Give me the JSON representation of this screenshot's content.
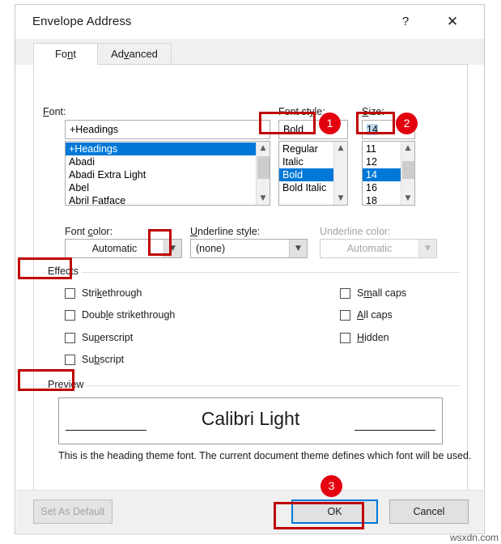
{
  "window": {
    "title": "Envelope Address",
    "help_icon": "question-mark-icon",
    "close_icon": "close-icon"
  },
  "tabs": [
    {
      "id": "font",
      "label_before": "Fo",
      "label_accel": "n",
      "label_after": "t",
      "active": true
    },
    {
      "id": "advanced",
      "label_before": "Ad",
      "label_accel": "v",
      "label_after": "anced",
      "active": false
    }
  ],
  "font_group": {
    "label_before": "",
    "label_accel": "F",
    "label_after": "ont:",
    "value": "+Headings",
    "items": [
      {
        "label": "+Headings",
        "selected": true
      },
      {
        "label": "Abadi",
        "selected": false
      },
      {
        "label": "Abadi Extra Light",
        "selected": false
      },
      {
        "label": "Abel",
        "selected": false
      },
      {
        "label": "Abril Fatface",
        "selected": false
      }
    ]
  },
  "style_group": {
    "label_before": "Font st",
    "label_accel": "y",
    "label_after": "le:",
    "value": "Bold",
    "items": [
      {
        "label": "Regular",
        "selected": false
      },
      {
        "label": "Italic",
        "selected": false
      },
      {
        "label": "Bold",
        "selected": true
      },
      {
        "label": "Bold Italic",
        "selected": false
      }
    ]
  },
  "size_group": {
    "label_before": "",
    "label_accel": "S",
    "label_after": "ize:",
    "value": "14",
    "items": [
      {
        "label": "11",
        "selected": false
      },
      {
        "label": "12",
        "selected": false
      },
      {
        "label": "14",
        "selected": true
      },
      {
        "label": "16",
        "selected": false
      },
      {
        "label": "18",
        "selected": false
      }
    ]
  },
  "font_color": {
    "label_before": "Font ",
    "label_accel": "c",
    "label_after": "olor:",
    "value": "Automatic",
    "dropdown_icon": "chevron-down-icon"
  },
  "underline_style": {
    "label_before": "",
    "label_accel": "U",
    "label_after": "nderline style:",
    "value": "(none)",
    "dropdown_icon": "chevron-down-icon"
  },
  "underline_color": {
    "label": "Underline color:",
    "value": "Automatic",
    "dropdown_icon": "chevron-down-icon",
    "disabled": true
  },
  "effects": {
    "group_label": "Effects",
    "left_column": [
      {
        "label_before": "Stri",
        "label_accel": "k",
        "label_after": "ethrough",
        "checked": false
      },
      {
        "label_before": "Doub",
        "label_accel": "l",
        "label_after": "e strikethrough",
        "checked": false
      },
      {
        "label_before": "Su",
        "label_accel": "p",
        "label_after": "erscript",
        "checked": false
      },
      {
        "label_before": "Su",
        "label_accel": "b",
        "label_after": "script",
        "checked": false
      }
    ],
    "right_column": [
      {
        "label_before": "S",
        "label_accel": "m",
        "label_after": "all caps",
        "checked": false
      },
      {
        "label_before": "",
        "label_accel": "A",
        "label_after": "ll caps",
        "checked": false
      },
      {
        "label_before": "",
        "label_accel": "H",
        "label_after": "idden",
        "checked": false
      }
    ]
  },
  "preview": {
    "group_label": "Preview",
    "sample_text": "Calibri Light",
    "note": "This is the heading theme font. The current document theme defines which font will be used."
  },
  "footer": {
    "set_as_default": "Set As Default",
    "ok": "OK",
    "cancel": "Cancel"
  },
  "annotations": {
    "badge_1": "1",
    "badge_2": "2",
    "badge_3": "3",
    "accent_red": "#c00000",
    "badge_red": "#e3000f",
    "focus_blue": "#0078d7"
  },
  "watermark": "wsxdn.com"
}
